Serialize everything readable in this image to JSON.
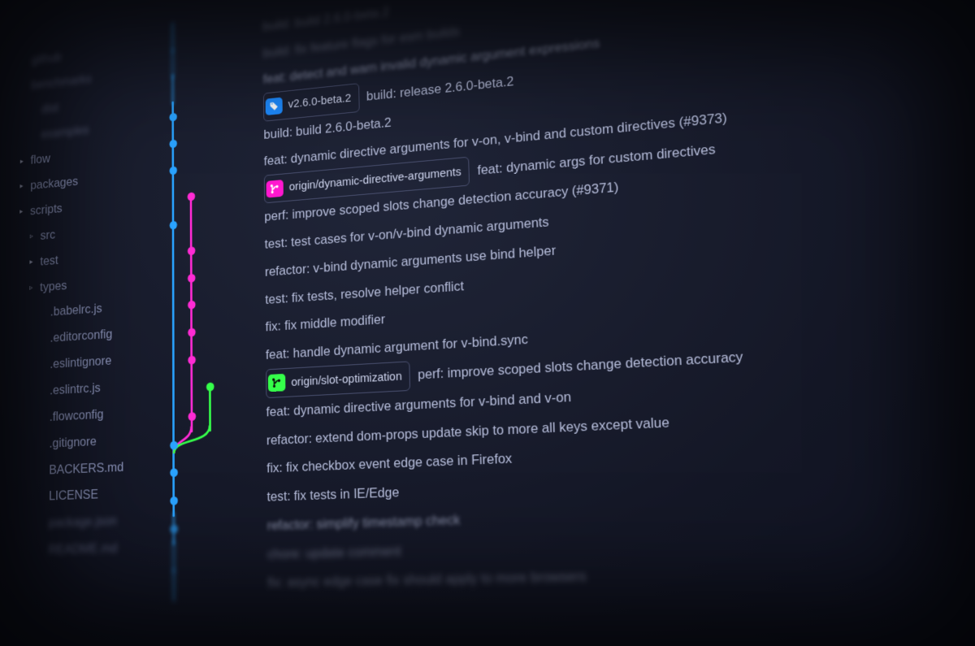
{
  "sidebar": {
    "items": [
      {
        "label": "github",
        "depth": 0,
        "arrow": "",
        "blurred": true
      },
      {
        "label": "benchmarks",
        "depth": 0,
        "arrow": "",
        "blurred": true
      },
      {
        "label": "dist",
        "depth": 1,
        "arrow": "",
        "blurred": true
      },
      {
        "label": "examples",
        "depth": 1,
        "arrow": "",
        "blurred": true
      },
      {
        "label": "flow",
        "depth": 0,
        "arrow": "▸",
        "blurred": false
      },
      {
        "label": "packages",
        "depth": 0,
        "arrow": "▸",
        "blurred": false
      },
      {
        "label": "scripts",
        "depth": 0,
        "arrow": "▸",
        "blurred": false
      },
      {
        "label": "src",
        "depth": 1,
        "arrow": "▹",
        "blurred": false
      },
      {
        "label": "test",
        "depth": 1,
        "arrow": "▸",
        "blurred": false
      },
      {
        "label": "types",
        "depth": 1,
        "arrow": "▹",
        "blurred": false
      },
      {
        "label": ".babelrc.js",
        "depth": 2,
        "arrow": "",
        "blurred": false
      },
      {
        "label": ".editorconfig",
        "depth": 2,
        "arrow": "",
        "blurred": false
      },
      {
        "label": ".eslintignore",
        "depth": 2,
        "arrow": "",
        "blurred": false
      },
      {
        "label": ".eslintrc.js",
        "depth": 2,
        "arrow": "",
        "blurred": false
      },
      {
        "label": ".flowconfig",
        "depth": 2,
        "arrow": "",
        "blurred": false
      },
      {
        "label": ".gitignore",
        "depth": 2,
        "arrow": "",
        "blurred": false
      },
      {
        "label": "BACKERS.md",
        "depth": 2,
        "arrow": "",
        "blurred": false
      },
      {
        "label": "LICENSE",
        "depth": 2,
        "arrow": "",
        "blurred": false
      },
      {
        "label": "package.json",
        "depth": 2,
        "arrow": "",
        "blurred": true
      },
      {
        "label": "README.md",
        "depth": 2,
        "arrow": "",
        "blurred": true
      }
    ]
  },
  "tags": {
    "version": {
      "label": "v2.6.0-beta.2",
      "color": "blue",
      "icon": "tag-icon"
    },
    "branch_a": {
      "label": "origin/dynamic-directive-arguments",
      "color": "pink",
      "icon": "branch-icon"
    },
    "branch_b": {
      "label": "origin/slot-optimization",
      "color": "green",
      "icon": "branch-icon"
    }
  },
  "commits": [
    {
      "msg": "build: build 2.6.0-beta.2",
      "lanes": [
        "blue"
      ],
      "dot": "",
      "blur": "blurred"
    },
    {
      "msg": "build: fix feature flags for esm builds",
      "lanes": [
        "blue"
      ],
      "dot": "",
      "blur": "blurred"
    },
    {
      "msg": "feat: detect and warn invalid dynamic argument expressions",
      "lanes": [
        "blue"
      ],
      "dot": "",
      "blur": "blurred2"
    },
    {
      "msg": "build: release 2.6.0-beta.2",
      "lanes": [
        "blue"
      ],
      "dot": "blue",
      "tag": "version"
    },
    {
      "msg": "build: build 2.6.0-beta.2",
      "lanes": [
        "blue"
      ],
      "dot": "blue"
    },
    {
      "msg": "feat: dynamic directive arguments for v-on, v-bind and custom directives (#9373)",
      "lanes": [
        "blue"
      ],
      "dot": "blue"
    },
    {
      "msg": "feat: dynamic args for custom directives",
      "lanes": [
        "blue",
        "pink"
      ],
      "dot": "pink",
      "tag": "branch_a",
      "branchStartPink": true
    },
    {
      "msg": "perf: improve scoped slots change detection accuracy (#9371)",
      "lanes": [
        "blue",
        "pink"
      ],
      "dot": "blue"
    },
    {
      "msg": "test: test cases for v-on/v-bind dynamic arguments",
      "lanes": [
        "blue",
        "pink"
      ],
      "dot": "pink"
    },
    {
      "msg": "refactor: v-bind dynamic arguments use bind helper",
      "lanes": [
        "blue",
        "pink"
      ],
      "dot": "pink"
    },
    {
      "msg": "test: fix tests, resolve helper conflict",
      "lanes": [
        "blue",
        "pink"
      ],
      "dot": "pink"
    },
    {
      "msg": "fix: fix middle modifier",
      "lanes": [
        "blue",
        "pink"
      ],
      "dot": "pink"
    },
    {
      "msg": "feat: handle dynamic argument for v-bind.sync",
      "lanes": [
        "blue",
        "pink"
      ],
      "dot": "pink"
    },
    {
      "msg": "perf: improve scoped slots change detection accuracy",
      "lanes": [
        "blue",
        "pink",
        "green"
      ],
      "dot": "green",
      "tag": "branch_b",
      "branchStartGreen": true
    },
    {
      "msg": "feat: dynamic directive arguments for v-bind and v-on",
      "lanes": [
        "blue",
        "pink",
        "green"
      ],
      "dot": "pink"
    },
    {
      "msg": "refactor: extend dom-props update skip to more all keys except value",
      "lanes": [
        "blue"
      ],
      "dot": "blue",
      "mergePinkGreen": true
    },
    {
      "msg": "fix: fix checkbox event edge case in Firefox",
      "lanes": [
        "blue"
      ],
      "dot": "blue"
    },
    {
      "msg": "test: fix tests in IE/Edge",
      "lanes": [
        "blue"
      ],
      "dot": "blue"
    },
    {
      "msg": "refactor: simplify timestamp check",
      "lanes": [
        "blue"
      ],
      "dot": "blue",
      "blur": "blurred2"
    },
    {
      "msg": "chore: update comment",
      "lanes": [
        "blue"
      ],
      "dot": "",
      "blur": "blurred"
    },
    {
      "msg": "fix: async edge case fix should apply to more browsers",
      "lanes": [
        "blue"
      ],
      "dot": "",
      "blur": "blurred"
    }
  ]
}
